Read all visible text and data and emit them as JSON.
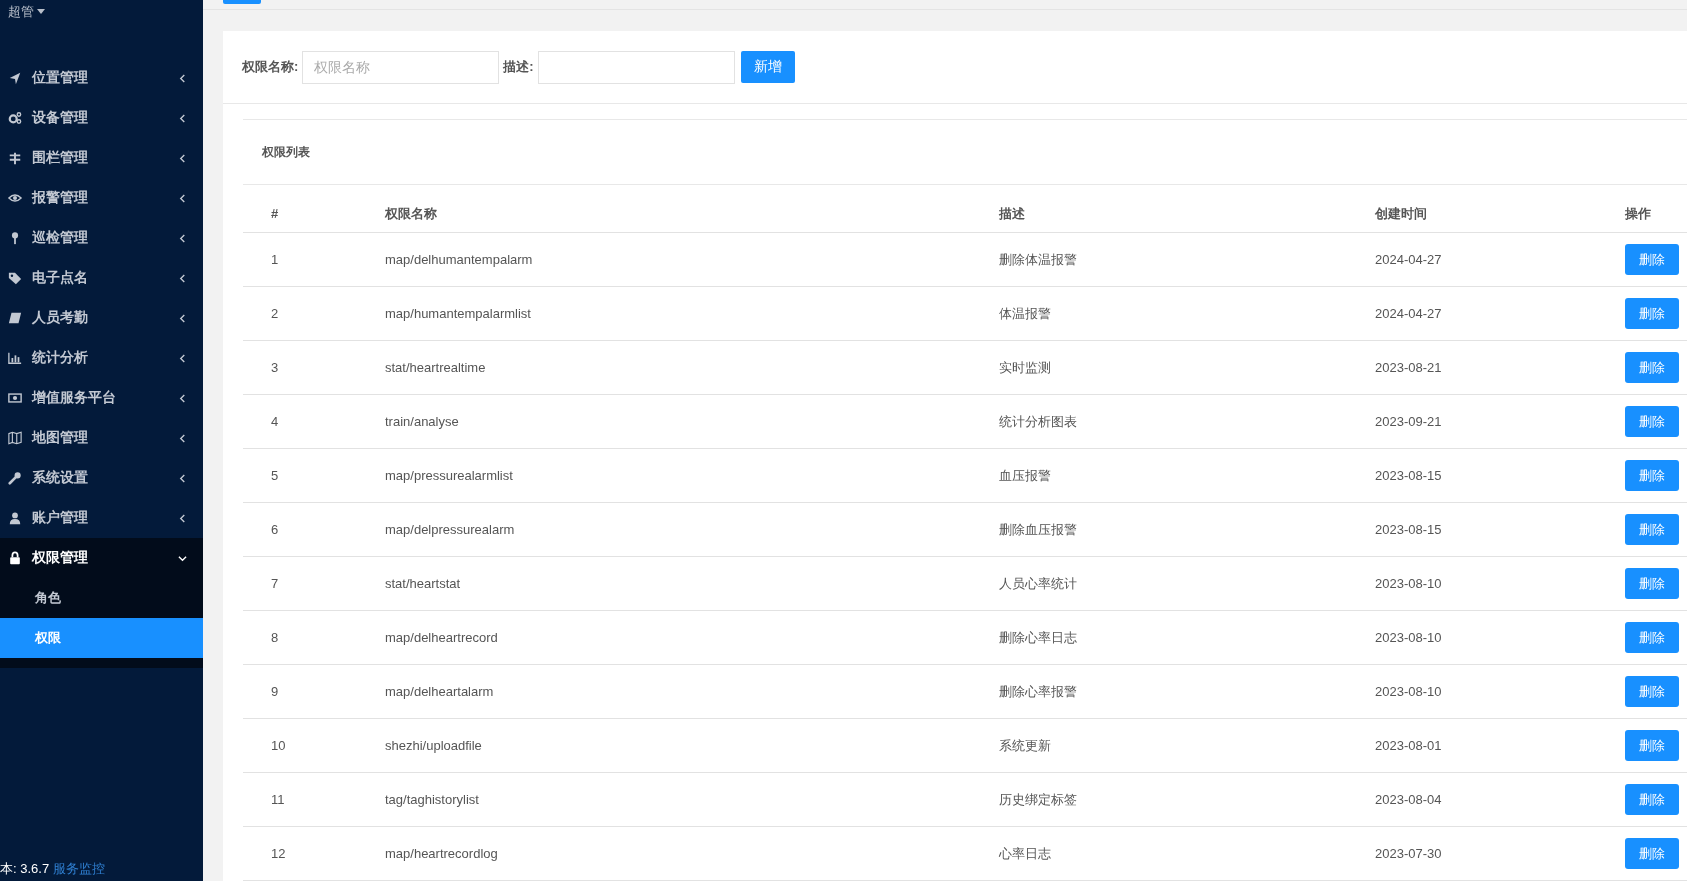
{
  "sidebar": {
    "user": "超管",
    "items": [
      {
        "label": "位置管理",
        "expanded": false
      },
      {
        "label": "设备管理",
        "expanded": false
      },
      {
        "label": "围栏管理",
        "expanded": false
      },
      {
        "label": "报警管理",
        "expanded": false
      },
      {
        "label": "巡检管理",
        "expanded": false
      },
      {
        "label": "电子点名",
        "expanded": false
      },
      {
        "label": "人员考勤",
        "expanded": false
      },
      {
        "label": "统计分析",
        "expanded": false
      },
      {
        "label": "增值服务平台",
        "expanded": false
      },
      {
        "label": "地图管理",
        "expanded": false
      },
      {
        "label": "系统设置",
        "expanded": false
      },
      {
        "label": "账户管理",
        "expanded": false
      },
      {
        "label": "权限管理",
        "expanded": true,
        "children": [
          {
            "label": "角色",
            "selected": false
          },
          {
            "label": "权限",
            "selected": true
          }
        ]
      }
    ],
    "version": "本: 3.6.7",
    "monitor_link": "服务监控"
  },
  "form": {
    "name_label": "权限名称:",
    "name_placeholder": "权限名称",
    "desc_label": "描述:",
    "add_button": "新增"
  },
  "table": {
    "title": "权限列表",
    "columns": [
      "#",
      "权限名称",
      "描述",
      "创建时间",
      "操作"
    ],
    "rows": [
      {
        "no": "1",
        "name": "map/delhumantempalarm",
        "desc": "删除体温报警",
        "date": "2024-04-27",
        "action": "删除"
      },
      {
        "no": "2",
        "name": "map/humantempalarmlist",
        "desc": "体温报警",
        "date": "2024-04-27",
        "action": "删除"
      },
      {
        "no": "3",
        "name": "stat/heartrealtime",
        "desc": "实时监测",
        "date": "2023-08-21",
        "action": "删除"
      },
      {
        "no": "4",
        "name": "train/analyse",
        "desc": "统计分析图表",
        "date": "2023-09-21",
        "action": "删除"
      },
      {
        "no": "5",
        "name": "map/pressurealarmlist",
        "desc": "血压报警",
        "date": "2023-08-15",
        "action": "删除"
      },
      {
        "no": "6",
        "name": "map/delpressurealarm",
        "desc": "删除血压报警",
        "date": "2023-08-15",
        "action": "删除"
      },
      {
        "no": "7",
        "name": "stat/heartstat",
        "desc": "人员心率统计",
        "date": "2023-08-10",
        "action": "删除"
      },
      {
        "no": "8",
        "name": "map/delheartrecord",
        "desc": "删除心率日志",
        "date": "2023-08-10",
        "action": "删除"
      },
      {
        "no": "9",
        "name": "map/delheartalarm",
        "desc": "删除心率报警",
        "date": "2023-08-10",
        "action": "删除"
      },
      {
        "no": "10",
        "name": "shezhi/uploadfile",
        "desc": "系统更新",
        "date": "2023-08-01",
        "action": "删除"
      },
      {
        "no": "11",
        "name": "tag/taghistorylist",
        "desc": "历史绑定标签",
        "date": "2023-08-04",
        "action": "删除"
      },
      {
        "no": "12",
        "name": "map/heartrecordlog",
        "desc": "心率日志",
        "date": "2023-07-30",
        "action": "删除"
      }
    ]
  }
}
